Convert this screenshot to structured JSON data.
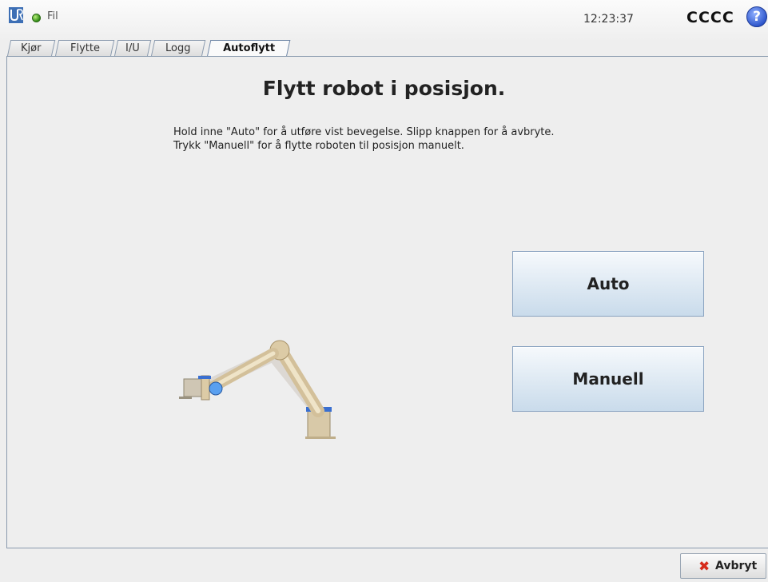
{
  "header": {
    "file_label": "Fil",
    "clock": "12:23:37",
    "robot_name": "CCCC",
    "help_glyph": "?",
    "logo_icon": "ur-logo-icon",
    "status_color": "#3a9a1a"
  },
  "tabs": [
    {
      "label": "Kjør",
      "active": false
    },
    {
      "label": "Flytte",
      "active": false
    },
    {
      "label": "I/U",
      "active": false
    },
    {
      "label": "Logg",
      "active": false
    },
    {
      "label": "Autoflytt",
      "active": true
    }
  ],
  "main": {
    "title": "Flytt robot i posisjon.",
    "instruction_line1": "Hold inne \"Auto\" for å utføre vist bevegelse. Slipp knappen for å avbryte.",
    "instruction_line2": "Trykk \"Manuell\" for å flytte roboten til posisjon manuelt.",
    "auto_button": "Auto",
    "manual_button": "Manuell"
  },
  "footer": {
    "cancel_label": "Avbryt",
    "cancel_icon": "✖"
  }
}
